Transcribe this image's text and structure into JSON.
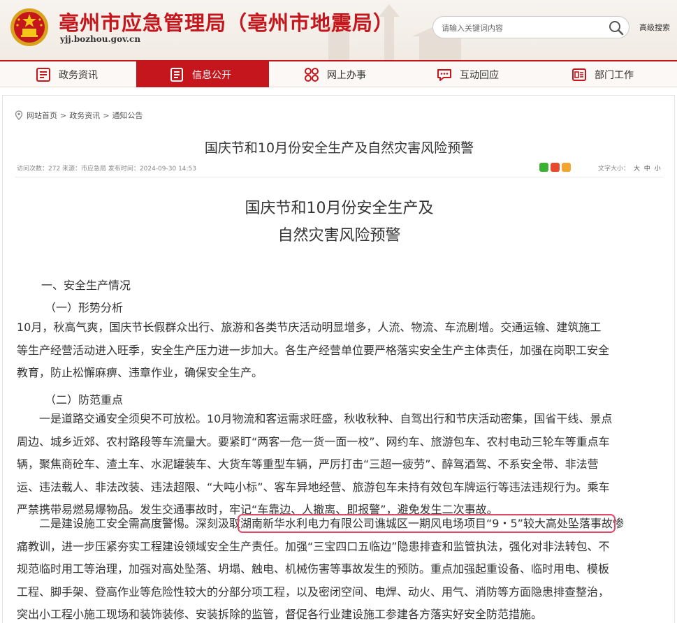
{
  "header": {
    "site_title": "亳州市应急管理局（亳州市地震局）",
    "site_url": "yjj.bozhou.gov.cn",
    "search_placeholder": "请输入关键词内容",
    "advanced_search": "高级搜索",
    "brand_color": "#c4161c"
  },
  "nav": {
    "items": [
      {
        "label": "政务资讯",
        "icon": "news-icon"
      },
      {
        "label": "信息公开",
        "icon": "document-icon",
        "active": true
      },
      {
        "label": "网上办事",
        "icon": "services-icon"
      },
      {
        "label": "互动回应",
        "icon": "chat-icon"
      },
      {
        "label": "部门工作",
        "icon": "department-icon"
      }
    ]
  },
  "breadcrumb": {
    "home": "网站首页",
    "level2": "政务资讯",
    "level3": "通知公告",
    "separator": ">"
  },
  "article": {
    "title": "国庆节和10月份安全生产及自然灾害风险预警",
    "meta_text": "访问次数：272  来源：市应急局  发布时间：2024-09-30 14:53",
    "font_size_label": "文字大小：",
    "font_size_options": [
      "大",
      "中",
      "小"
    ],
    "doc_title_line1": "国庆节和10月份安全生产及",
    "doc_title_line2": "自然灾害风险预警",
    "section1": "一、安全生产情况",
    "sub1": "（一）形势分析",
    "para1": [
      "10月，秋高气爽，国庆节长假群众出行、旅游和各类节庆活动明显增多，人流、物流、车流剧增。交通运输、建筑施工",
      "等生产经营活动进入旺季，安全生产压力进一步加大。各生产经营单位要严格落实安全生产主体责任，加强在岗职工安全",
      "教育，防止松懈麻痹、违章作业，确保安全生产。"
    ],
    "sub2": "（二）防范重点",
    "para2": [
      "　　一是道路交通安全须臾不可放松。10月物流和客运需求旺盛，秋收秋种、自驾出行和节庆活动密集，国省干线、景点",
      "周边、城乡近郊、农村路段等车流量大。要紧盯“两客一危一货一面一校”、网约车、旅游包车、农村电动三轮车等重点车",
      "辆，聚焦商砼车、渣土车、水泥罐装车、大货车等重型车辆，严厉打击“三超一疲劳”、醉驾酒驾、不系安全带、非法营",
      "运、违法载人、非法改装、违法超限、“大吨小标”、客车异地经营、旅游包车未持有效包车牌运行等违法违规行为。乘车",
      "严禁携带易燃易爆物品。发生交通事故时，牢记“车靠边、人撤离、即报警”，避免发生二次事故。"
    ],
    "para3_line1_pre": "　　二是建设施工安全需高度警惕。深刻汲取",
    "para3_highlight": "湖南新华水利电力有限公司谯城区一期风电场项目“9・5”较大高处坠落事故",
    "para3_line1_post": "惨",
    "para3": [
      "痛教训，进一步压紧夯实工程建设领域安全生产责任。加强“三宝四口五临边”隐患排查和监管执法，强化对非法转包、不",
      "规范临时用工等治理，加强对高处坠落、坍塌、触电、机械伤害等事故发生的预防。重点加强起重设备、临时用电、模板",
      "工程、脚手架、登高作业等危险性较大的分部分项工程，以及密闭空间、电焊、动火、用气、消防等方面隐患排查整治，",
      "突出小工程小施工现场和装饰装修、安装拆除的监管，督促各行业建设施工参建各方落实好安全防范措施。"
    ]
  }
}
